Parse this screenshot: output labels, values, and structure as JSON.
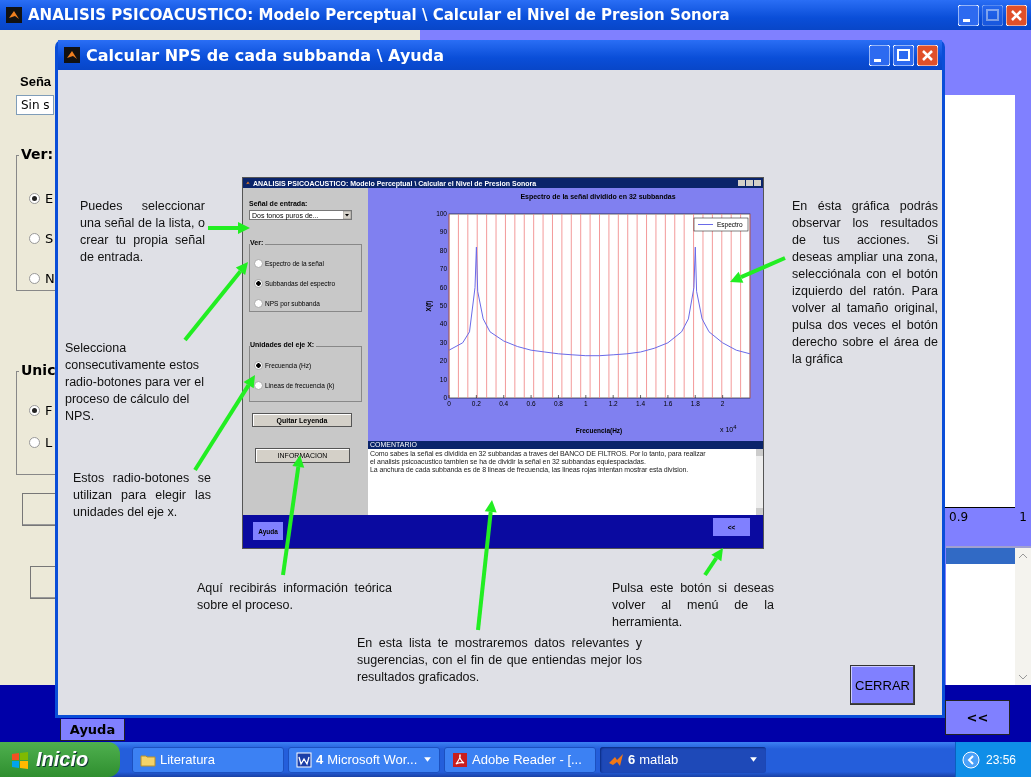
{
  "background_window": {
    "title": "ANALISIS PSICOACUSTICO: Modelo Perceptual \\ Calcular el Nivel de Presion Sonora",
    "input_label": "Seña",
    "input_value": "Sin s",
    "view_group": {
      "label": "Ver:",
      "options": [
        {
          "label": "E",
          "selected": true
        },
        {
          "label": "S",
          "selected": false
        },
        {
          "label": "N",
          "selected": false
        }
      ]
    },
    "units_group": {
      "label": "Unic",
      "options": [
        {
          "label": "F",
          "selected": true
        },
        {
          "label": "L",
          "selected": false
        }
      ]
    },
    "plot_ticks": [
      "0.9",
      "1"
    ],
    "help_button": "Ayuda",
    "back_button": "<<"
  },
  "help_window": {
    "title": "Calcular NPS de cada subbanda \\ Ayuda",
    "screenshot": {
      "title": "ANALISIS PSICOACUSTICO: Modelo Perceptual \\ Calcular el Nivel de Presion Sonora",
      "input_label": "Señal de entrada:",
      "input_value": "Dos tonos puros de...",
      "view_group": {
        "label": "Ver:",
        "options": [
          {
            "label": "Espectro de la señal",
            "selected": false
          },
          {
            "label": "Subbandas del espectro",
            "selected": true
          },
          {
            "label": "NPS por subbanda",
            "selected": false
          }
        ]
      },
      "units_group": {
        "label": "Unidades del eje X:",
        "options": [
          {
            "label": "Frecuencia (Hz)",
            "selected": true
          },
          {
            "label": "Lineas de frecuencia (k)",
            "selected": false
          }
        ]
      },
      "legend_button": "Quitar Leyenda",
      "info_button": "INFORMACION",
      "chart_data": {
        "type": "line",
        "title": "Espectro de la señal dividido en 32 subbandas",
        "xlabel": "Frecuencia(Hz)",
        "ylabel": "X(f)",
        "x": [
          0,
          0.1,
          0.15,
          0.19,
          0.2,
          0.21,
          0.25,
          0.3,
          0.4,
          0.5,
          0.6,
          0.7,
          0.8,
          0.9,
          1.0,
          1.1,
          1.2,
          1.3,
          1.4,
          1.5,
          1.6,
          1.7,
          1.75,
          1.79,
          1.8,
          1.81,
          1.85,
          1.9,
          2.0,
          2.1,
          2.2
        ],
        "series": [
          {
            "name": "Espectro",
            "color": "#6a6ae8",
            "values": [
              26,
              30,
              36,
              60,
              82,
              58,
              43,
              36,
              31,
              28,
              26,
              25,
              24,
              23.5,
              23,
              23,
              23.5,
              24,
              25,
              27,
              30,
              36,
              43,
              60,
              82,
              58,
              43,
              36,
              30,
              26,
              24
            ]
          }
        ],
        "xlim": [
          0,
          2.2
        ],
        "ylim": [
          0,
          100
        ],
        "xticks": [
          0,
          0.2,
          0.4,
          0.6,
          0.8,
          1,
          1.2,
          1.4,
          1.6,
          1.8,
          2
        ],
        "yticks": [
          0,
          10,
          20,
          30,
          40,
          50,
          60,
          70,
          80,
          90,
          100
        ],
        "annotations": [
          "x 10$^{4}$"
        ]
      },
      "comment": {
        "title": "COMENTARIO",
        "lines": [
          "Como sabes la señal es dividida en 32 subbandas a traves del BANCO DE FILTROS. Por lo tanto, para realizar",
          "el analisis psicoacustico tambien se ha de dividir la señal en 32 subbandas equiespaciadas.",
          "La anchura de cada subbanda es de 8 lineas de frecuencia, las lineas rojas intentan mostrar esta division."
        ]
      },
      "help_button": "Ayuda",
      "back_button": "<<"
    },
    "annotations": [
      {
        "text": "Puedes seleccionar una señal de la lista, o crear tu propia señal de entrada."
      },
      {
        "text": "Selecciona consecutivamente estos radio-botones para ver el proceso de cálculo del NPS."
      },
      {
        "text": "Estos radio-botones se utilizan para elegir las unidades del eje x."
      },
      {
        "text": "Aquí recibirás información teórica sobre el proceso."
      },
      {
        "text": "En esta lista te mostraremos datos relevantes y sugerencias, con el fin de que entiendas mejor los resultados graficados."
      },
      {
        "text": "Pulsa este botón si deseas volver al menú de la herramienta."
      },
      {
        "text": "En ésta gráfica podrás observar los resultados de tus acciones. Si deseas ampliar una zona, selecciónala con el botón izquierdo del ratón. Para volver al tamaño original, pulsa dos veces el botón derecho sobre el área de la gráfica"
      }
    ],
    "close_button": "CERRAR"
  },
  "taskbar": {
    "start": "Inicio",
    "items": [
      {
        "kind": "folder",
        "label": "Literatura",
        "grouped": false,
        "selected": false
      },
      {
        "kind": "word",
        "count": "4",
        "label": "Microsoft Wor...",
        "grouped": true,
        "selected": false
      },
      {
        "kind": "pdf",
        "label": "Adobe Reader - [...",
        "grouped": false,
        "selected": false
      },
      {
        "kind": "matlab",
        "count": "6",
        "label": "matlab",
        "grouped": true,
        "selected": true
      }
    ],
    "clock": "23:56"
  }
}
